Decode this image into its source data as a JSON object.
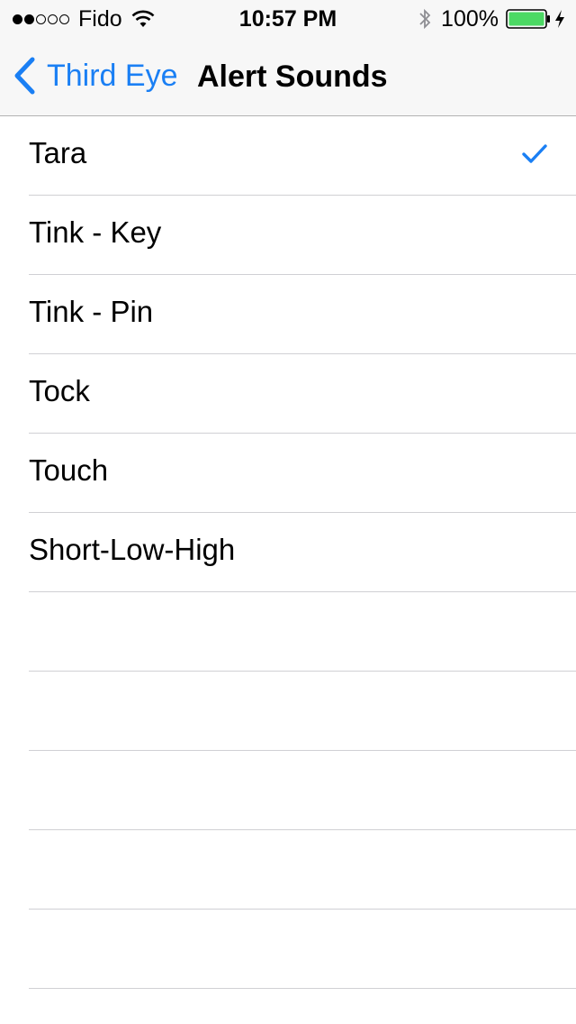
{
  "status_bar": {
    "carrier": "Fido",
    "time": "10:57 PM",
    "battery_percent": "100%",
    "signal_bars_filled": 2,
    "signal_bars_total": 5
  },
  "nav": {
    "back_label": "Third Eye",
    "title": "Alert Sounds"
  },
  "colors": {
    "accent": "#1a7ff4",
    "battery_fill": "#4cd964",
    "separator": "#d0d0d4"
  },
  "icons": [
    "wifi-icon",
    "bluetooth-icon",
    "battery-icon",
    "charging-icon",
    "back-chevron-icon",
    "checkmark-icon"
  ],
  "sounds": [
    {
      "label": "Tara",
      "selected": true
    },
    {
      "label": "Tink - Key",
      "selected": false
    },
    {
      "label": "Tink - Pin",
      "selected": false
    },
    {
      "label": "Tock",
      "selected": false
    },
    {
      "label": "Touch",
      "selected": false
    },
    {
      "label": "Short-Low-High",
      "selected": false
    },
    {
      "label": "",
      "selected": false
    },
    {
      "label": "",
      "selected": false
    },
    {
      "label": "",
      "selected": false
    },
    {
      "label": "",
      "selected": false
    },
    {
      "label": "",
      "selected": false
    },
    {
      "label": "",
      "selected": false
    }
  ]
}
